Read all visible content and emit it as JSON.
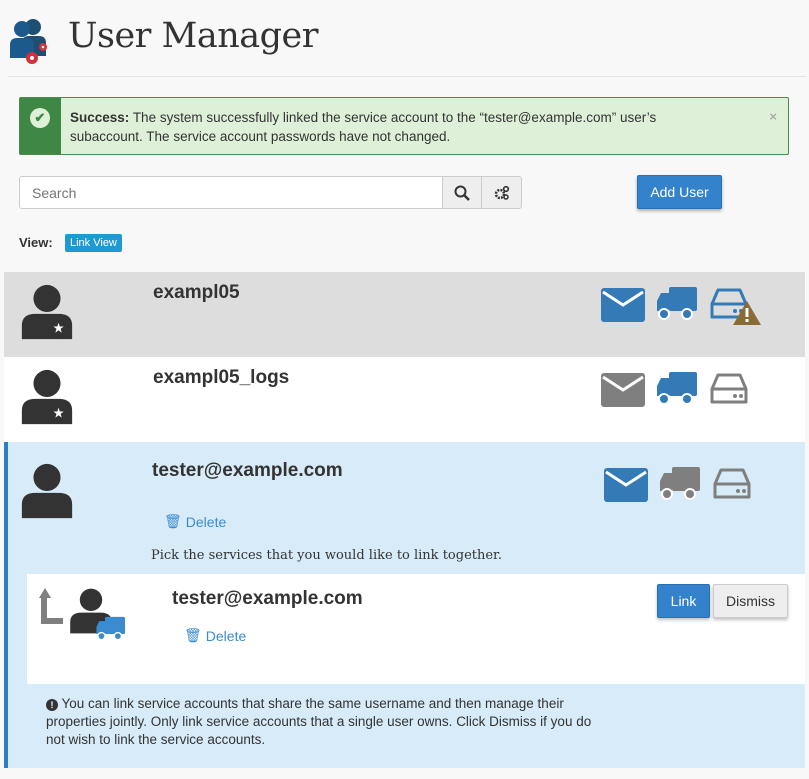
{
  "header": {
    "title": "User Manager",
    "icon": "users-gear-icon"
  },
  "alert": {
    "label": "Success:",
    "message": "The system successfully linked the service account to the “tester@example.com” user’s subaccount. The service account passwords have not changed.",
    "close": "×"
  },
  "search": {
    "placeholder": "Search",
    "value": ""
  },
  "toolbar": {
    "add_user": "Add User",
    "view_label": "View:",
    "view_value": "Link View"
  },
  "users": [
    {
      "name": "exampl05",
      "services": {
        "email": "active",
        "ftp": "active",
        "web": "active-warning"
      }
    },
    {
      "name": "exampl05_logs",
      "services": {
        "email": "inactive",
        "ftp": "active",
        "web": "inactive"
      }
    },
    {
      "name": "tester@example.com",
      "services": {
        "email": "active",
        "ftp": "inactive",
        "web": "inactive"
      },
      "delete_label": "Delete",
      "link_prompt": "Pick the services that you would like to link together."
    }
  ],
  "link_candidate": {
    "name": "tester@example.com",
    "delete_label": "Delete",
    "link_button": "Link",
    "dismiss_button": "Dismiss",
    "info": "You can link service accounts that share the same username and then manage their properties jointly. Only link service accounts that a single user owns. Click Dismiss if you do not wish to link the service accounts."
  },
  "colors": {
    "active": "#337ab7",
    "inactive": "#7f7f7f",
    "warning": "#8a6a35",
    "success": "#3e8745"
  }
}
